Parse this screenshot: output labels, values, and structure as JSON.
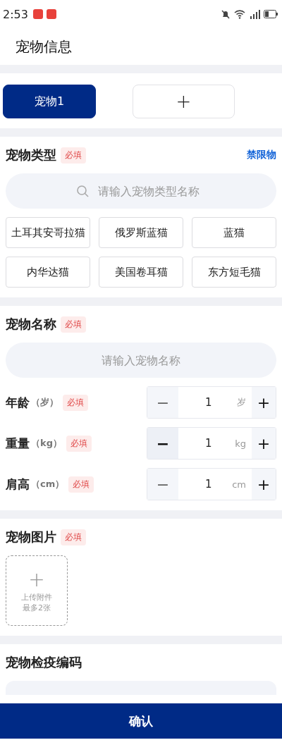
{
  "status_bar": {
    "time": "2:53"
  },
  "header": {
    "title": "宠物信息"
  },
  "pet_tabs": [
    {
      "kind": "pet",
      "label": "宠物1",
      "selected": true
    },
    {
      "kind": "add",
      "label": "+",
      "selected": false
    }
  ],
  "pet_type": {
    "label": "宠物类型",
    "required": "必填",
    "link": "禁限物",
    "search": {
      "placeholder": "请输入宠物类型名称"
    },
    "options": [
      {
        "label": "土耳其安哥拉猫",
        "selected": false
      },
      {
        "label": "俄罗斯蓝猫",
        "selected": false
      },
      {
        "label": "蓝猫",
        "selected": false
      },
      {
        "label": "内华达猫",
        "selected": false
      },
      {
        "label": "美国卷耳猫",
        "selected": false
      },
      {
        "label": "东方短毛猫",
        "selected": false
      }
    ]
  },
  "pet_name": {
    "label": "宠物名称",
    "required": "必填",
    "placeholder": "请输入宠物名称"
  },
  "measures": [
    {
      "label": "年龄",
      "unit_label": "（岁）",
      "required": "必填",
      "minus": "−",
      "minus_disabled": true,
      "value": "1",
      "unit": "岁",
      "plus": "+"
    },
    {
      "label": "重量",
      "unit_label": "（kg）",
      "required": "必填",
      "minus": "−",
      "minus_disabled": false,
      "value": "1",
      "unit": "kg",
      "plus": "+"
    },
    {
      "label": "肩高",
      "unit_label": "（cm）",
      "required": "必填",
      "minus": "−",
      "minus_disabled": true,
      "value": "1",
      "unit": "cm",
      "plus": "+"
    }
  ],
  "pet_photo": {
    "label": "宠物图片",
    "required": "必填",
    "upload": {
      "plus": "+",
      "text": "上传附件",
      "limit": "最多2张"
    }
  },
  "quarantine": {
    "label": "宠物检疫编码"
  },
  "confirm_button": "确认"
}
